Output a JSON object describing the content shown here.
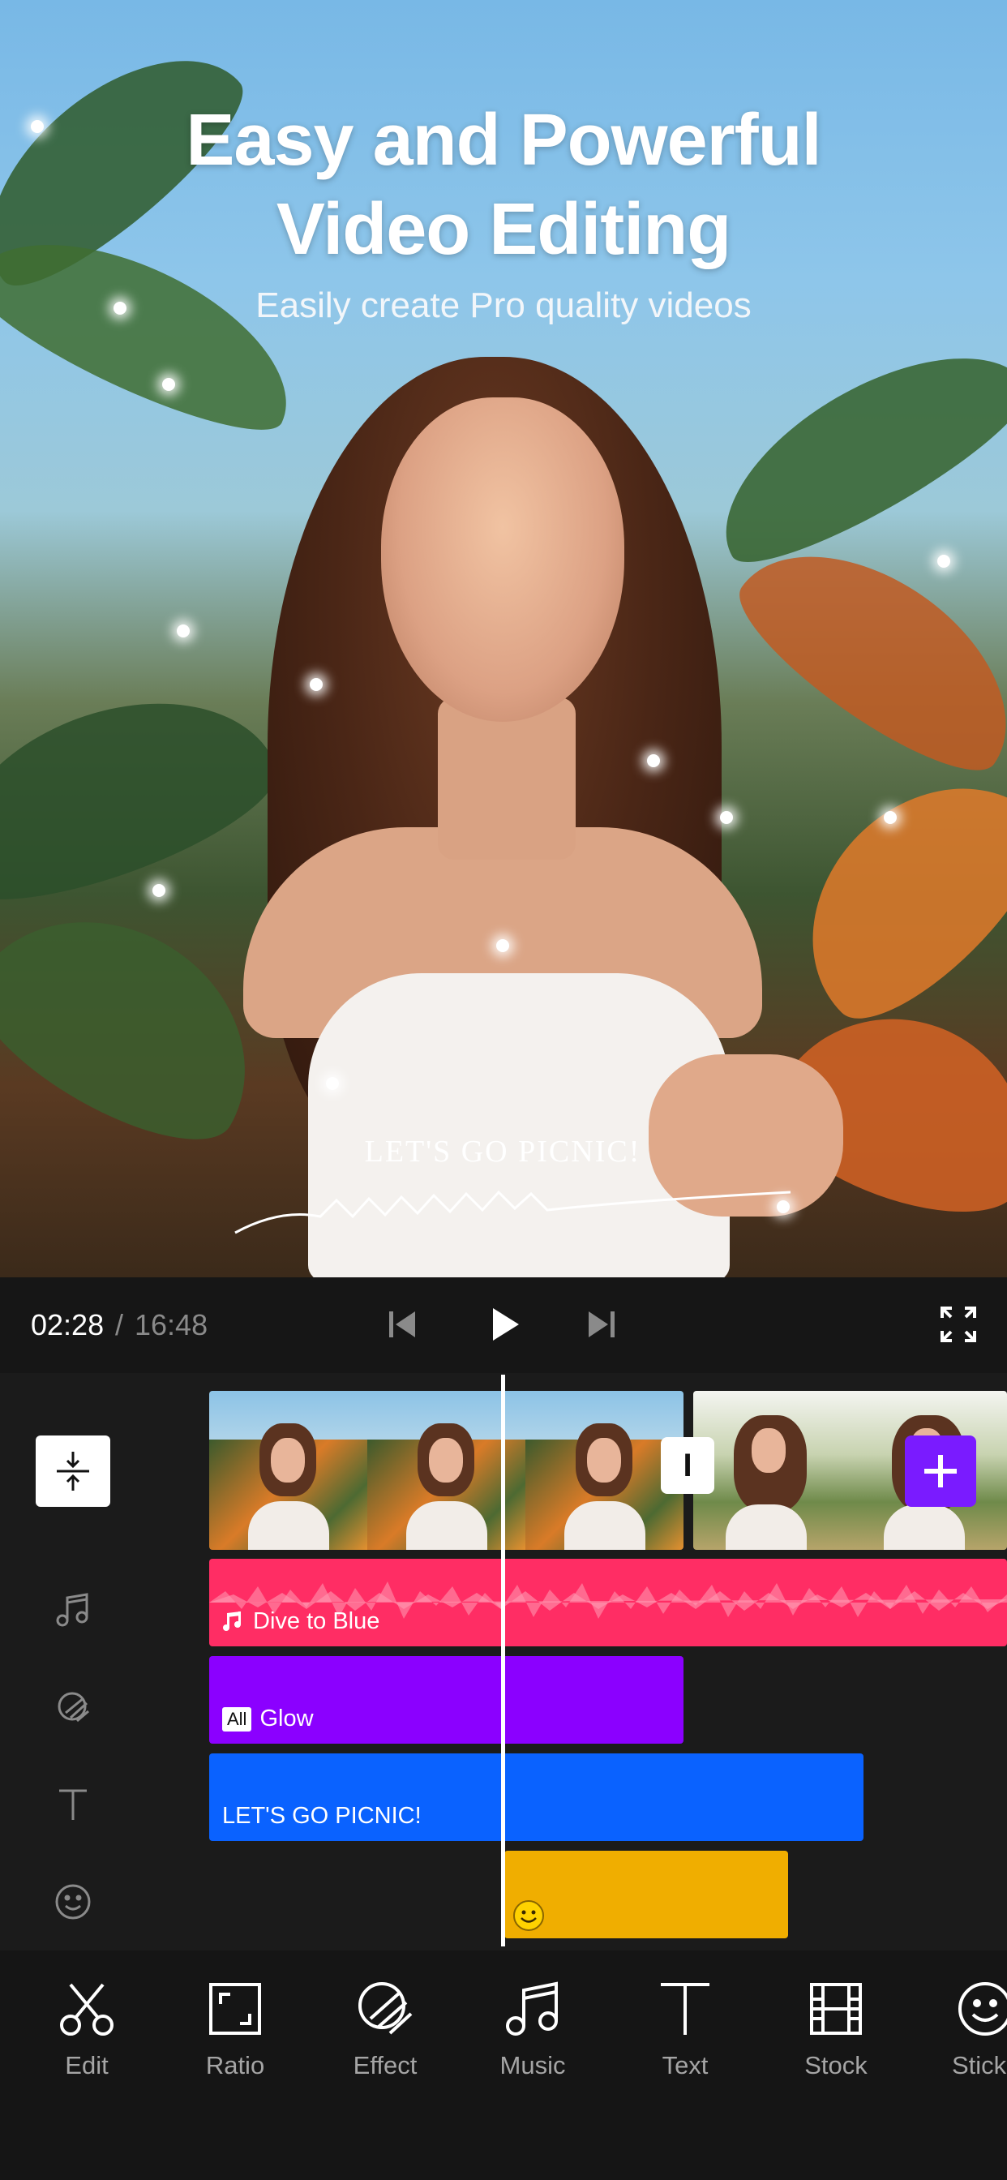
{
  "hero": {
    "title_line1": "Easy and Powerful",
    "title_line2": "Video Editing",
    "subtitle": "Easily create Pro quality videos",
    "overlay_text": "LET'S GO PICNIC!"
  },
  "player": {
    "current_time": "02:28",
    "separator": "/",
    "total_time": "16:48",
    "icons": [
      "skip-back-icon",
      "play-icon",
      "skip-forward-icon",
      "fullscreen-icon"
    ]
  },
  "timeline": {
    "split_marker_label": "I",
    "tracks": {
      "music": {
        "label": "Dive to Blue"
      },
      "effect": {
        "badge": "All",
        "label": "Glow"
      },
      "text": {
        "label": "LET'S GO PICNIC!"
      },
      "sticker": {
        "icon": "smiley-sticker-icon"
      }
    },
    "colors": {
      "music": "#ff2d64",
      "effect": "#8b00ff",
      "text": "#0a62ff",
      "sticker": "#f0ae00",
      "add_button": "#7a1bff"
    }
  },
  "toolbar": {
    "items": [
      {
        "label": "Edit",
        "icon": "scissors-icon"
      },
      {
        "label": "Ratio",
        "icon": "ratio-icon"
      },
      {
        "label": "Effect",
        "icon": "effect-icon"
      },
      {
        "label": "Music",
        "icon": "music-note-icon"
      },
      {
        "label": "Text",
        "icon": "text-icon"
      },
      {
        "label": "Stock",
        "icon": "film-icon"
      },
      {
        "label": "Stick",
        "icon": "smiley-icon"
      }
    ]
  }
}
